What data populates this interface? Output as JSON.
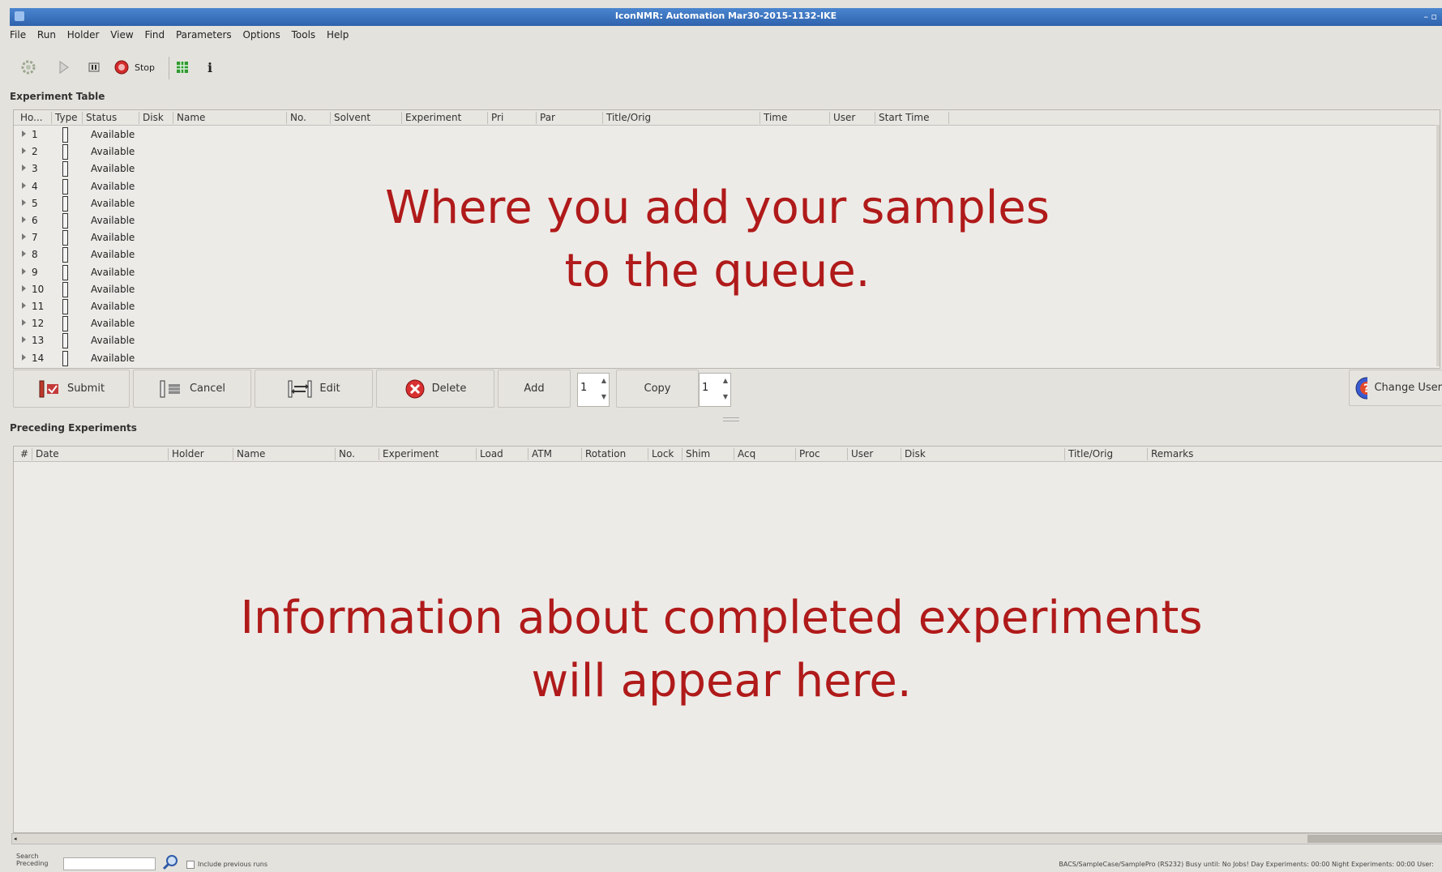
{
  "window": {
    "title": "IconNMR: Automation Mar30-2015-1132-IKE",
    "controls": "– ▫"
  },
  "menu": [
    "File",
    "Run",
    "Holder",
    "View",
    "Find",
    "Parameters",
    "Options",
    "Tools",
    "Help"
  ],
  "toolbar": {
    "stop_label": "Stop"
  },
  "experiment_table": {
    "label": "Experiment Table",
    "columns": [
      "Ho...",
      "Type",
      "Status",
      "Disk",
      "Name",
      "No.",
      "Solvent",
      "Experiment",
      "Pri",
      "Par",
      "Title/Orig",
      "Time",
      "User",
      "Start Time"
    ],
    "rows": [
      {
        "holder": "1",
        "status": "Available"
      },
      {
        "holder": "2",
        "status": "Available"
      },
      {
        "holder": "3",
        "status": "Available"
      },
      {
        "holder": "4",
        "status": "Available"
      },
      {
        "holder": "5",
        "status": "Available"
      },
      {
        "holder": "6",
        "status": "Available"
      },
      {
        "holder": "7",
        "status": "Available"
      },
      {
        "holder": "8",
        "status": "Available"
      },
      {
        "holder": "9",
        "status": "Available"
      },
      {
        "holder": "10",
        "status": "Available"
      },
      {
        "holder": "11",
        "status": "Available"
      },
      {
        "holder": "12",
        "status": "Available"
      },
      {
        "holder": "13",
        "status": "Available"
      },
      {
        "holder": "14",
        "status": "Available"
      }
    ],
    "overlay_line1": "Where you add your samples",
    "overlay_line2": "to the queue."
  },
  "actions": {
    "submit": "Submit",
    "cancel": "Cancel",
    "edit": "Edit",
    "delete": "Delete",
    "add": "Add",
    "add_count": "1",
    "copy": "Copy",
    "copy_count": "1",
    "change_user": "Change User"
  },
  "preceding": {
    "label": "Preceding Experiments",
    "columns": [
      "#",
      "Date",
      "Holder",
      "Name",
      "No.",
      "Experiment",
      "Load",
      "ATM",
      "Rotation",
      "Lock",
      "Shim",
      "Acq",
      "Proc",
      "User",
      "Disk",
      "Title/Orig",
      "Remarks"
    ],
    "overlay_line1": "Information about completed experiments",
    "overlay_line2": "will appear here."
  },
  "statusbar": {
    "search_label_1": "Search",
    "search_label_2": "Preceding",
    "include_label": "Include previous runs",
    "status_text": "BACS/SampleCase/SamplePro (RS232)   Busy until:  No Jobs!   Day Experiments: 00:00   Night Experiments: 00:00   User:"
  }
}
